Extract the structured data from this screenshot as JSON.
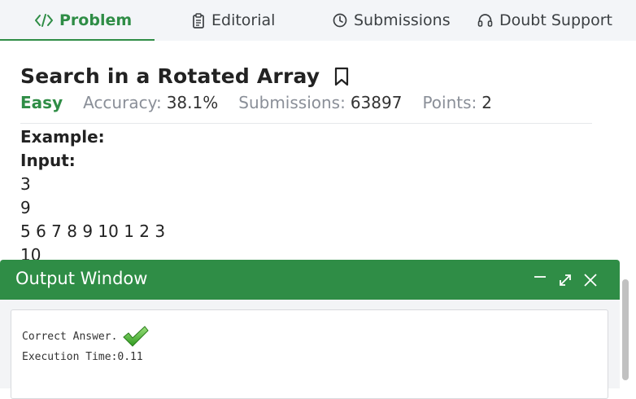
{
  "tabs": [
    {
      "label": "Problem",
      "icon": "code-icon",
      "active": true
    },
    {
      "label": "Editorial",
      "icon": "document-icon",
      "active": false
    },
    {
      "label": "Submissions",
      "icon": "clock-icon",
      "active": false
    },
    {
      "label": "Doubt Support",
      "icon": "headset-icon",
      "active": false
    }
  ],
  "problem": {
    "title": "Search in a Rotated Array",
    "difficulty": "Easy",
    "accuracy_label": "Accuracy:",
    "accuracy_value": "38.1%",
    "submissions_label": "Submissions:",
    "submissions_value": "63897",
    "points_label": "Points:",
    "points_value": "2"
  },
  "example": {
    "heading": "Example:",
    "input_label": "Input:",
    "lines": [
      "3",
      "9",
      "5 6 7 8 9 10 1 2 3",
      "10"
    ]
  },
  "output_window": {
    "title": "Output Window",
    "result": "Correct Answer.",
    "execution": "Execution Time:0.11"
  },
  "colors": {
    "accent": "#2f8d46",
    "tabbar_bg": "#f3f5f8",
    "check_green": "#43b02a"
  }
}
